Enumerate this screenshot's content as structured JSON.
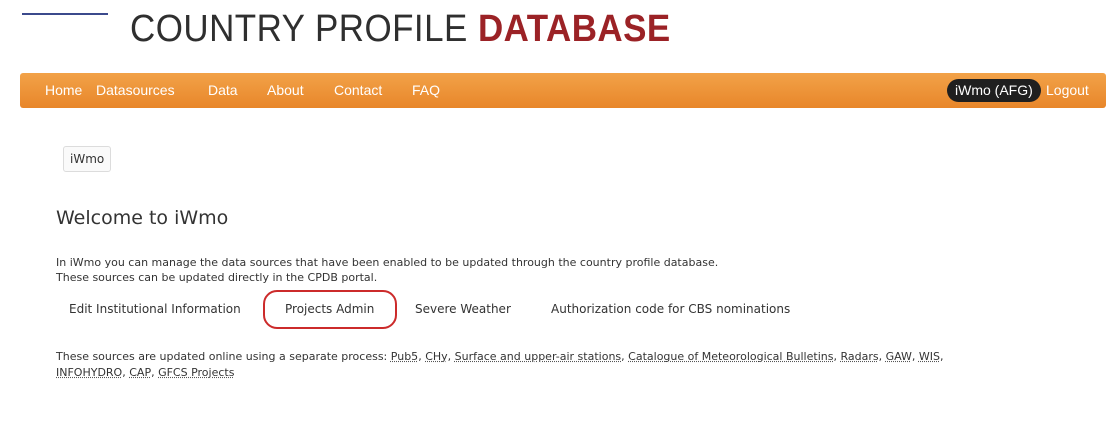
{
  "header": {
    "logo_part1": "COUNTRY PROFILE ",
    "logo_part2": "DATABASE"
  },
  "navbar": {
    "items": [
      "Home",
      "Datasources",
      "Data",
      "About",
      "Contact",
      "FAQ"
    ],
    "user_badge": "iWmo (AFG)",
    "logout": "Logout"
  },
  "tabs": {
    "active": "iWmo"
  },
  "main": {
    "title": "Welcome to iWmo",
    "intro_line1": "In iWmo you can manage the data sources that have been enabled to be updated through the country profile database.",
    "intro_line2": "These sources can be updated directly in the CPDB portal.",
    "buttons": [
      "Edit Institutional Information",
      "Projects Admin",
      "Severe Weather",
      "Authorization code for CBS nominations"
    ],
    "sources_prefix": "These sources are updated online using a separate process:",
    "sources_links": [
      "Pub5",
      "CHy",
      "Surface and upper-air stations",
      "Catalogue of Meteorological Bulletins",
      "Radars",
      "GAW",
      "WIS",
      "INFOHYDRO",
      "CAP",
      "GFCS Projects"
    ]
  },
  "colors": {
    "nav_orange": "#e8862a",
    "logo_red": "#9b2226",
    "highlight_red": "#cc2b2b"
  }
}
